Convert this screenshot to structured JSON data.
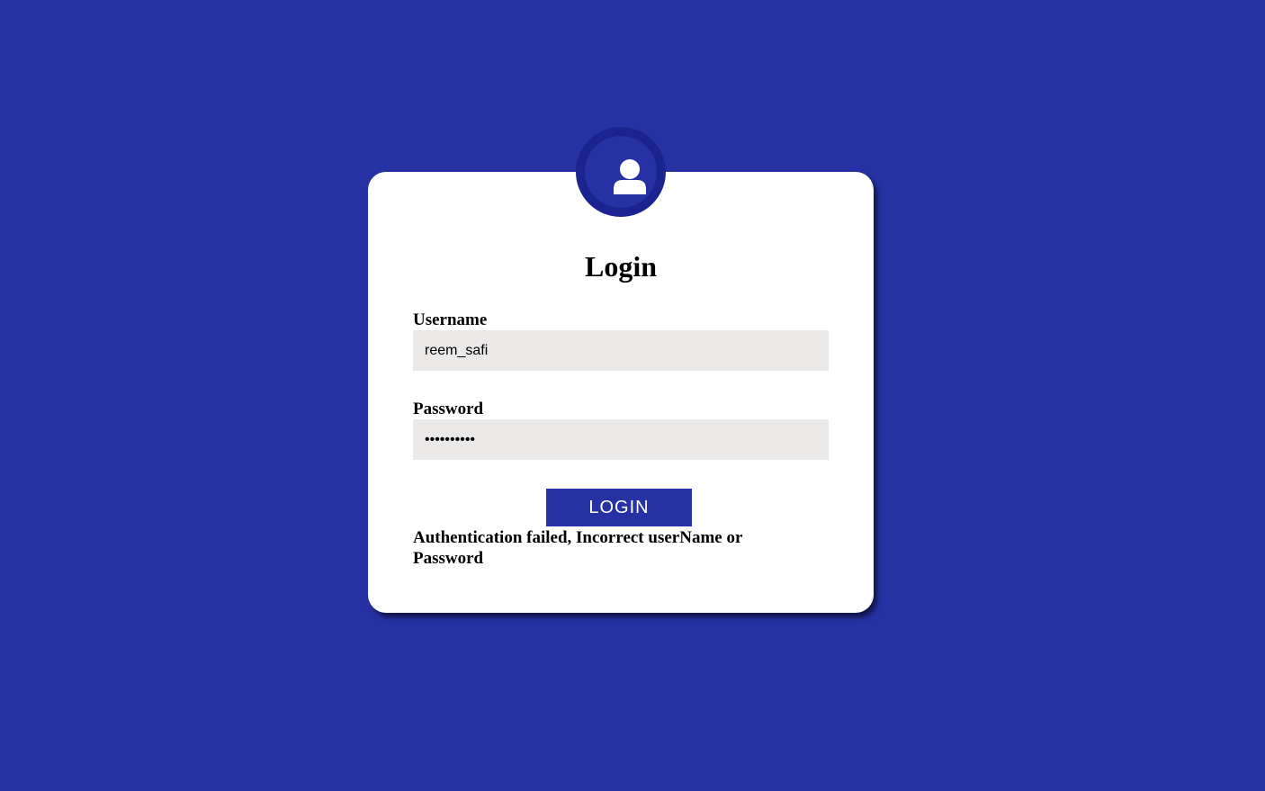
{
  "page": {
    "background": "#2631a3",
    "card_background": "#ffffff",
    "accent": "#2631a3"
  },
  "avatar": {
    "icon": "user-icon"
  },
  "form": {
    "title": "Login",
    "username_label": "Username",
    "username_value": "reem_safi",
    "password_label": "Password",
    "password_value": "••••••••••",
    "login_label": "LOGIN",
    "error_message": "Authentication failed, Incorrect userName or Password"
  }
}
